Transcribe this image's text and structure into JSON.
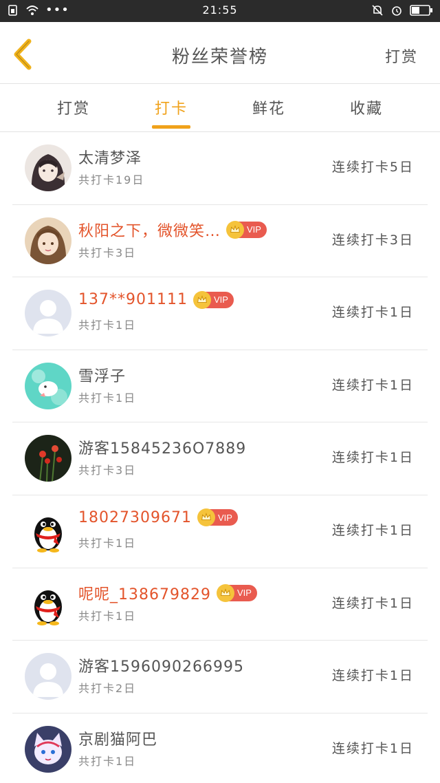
{
  "status_bar": {
    "time": "21:55"
  },
  "header": {
    "title": "粉丝荣誉榜",
    "action": "打赏"
  },
  "tabs": [
    {
      "label": "打赏",
      "active": false
    },
    {
      "label": "打卡",
      "active": true
    },
    {
      "label": "鲜花",
      "active": false
    },
    {
      "label": "收藏",
      "active": false
    }
  ],
  "colors": {
    "accent": "#f0a21b",
    "vip_name": "#e3542b",
    "vip_badge": "#e95b4f"
  },
  "vip_label": "VIP",
  "rows": [
    {
      "name": "太清梦泽",
      "vip": false,
      "total": "共打卡19日",
      "streak": "连续打卡5日",
      "avatar": "anime-avatar"
    },
    {
      "name": "秋阳之下，微微笑…",
      "vip": true,
      "total": "共打卡3日",
      "streak": "连续打卡3日",
      "avatar": "anime-girl-avatar"
    },
    {
      "name": "137**901111",
      "vip": true,
      "total": "共打卡1日",
      "streak": "连续打卡1日",
      "avatar": "default-avatar"
    },
    {
      "name": "雪浮子",
      "vip": false,
      "total": "共打卡1日",
      "streak": "连续打卡1日",
      "avatar": "bird-avatar"
    },
    {
      "name": "游客15845236O7889",
      "vip": false,
      "total": "共打卡3日",
      "streak": "连续打卡1日",
      "avatar": "flower-avatar"
    },
    {
      "name": "18027309671",
      "vip": true,
      "total": "共打卡1日",
      "streak": "连续打卡1日",
      "avatar": "qq-penguin-avatar"
    },
    {
      "name": "呢呢_138679829",
      "vip": true,
      "total": "共打卡1日",
      "streak": "连续打卡1日",
      "avatar": "qq-penguin-avatar"
    },
    {
      "name": "游客1596090266995",
      "vip": false,
      "total": "共打卡2日",
      "streak": "连续打卡1日",
      "avatar": "default-avatar"
    },
    {
      "name": "京剧猫阿巴",
      "vip": false,
      "total": "共打卡1日",
      "streak": "连续打卡1日",
      "avatar": "cat-avatar"
    }
  ]
}
